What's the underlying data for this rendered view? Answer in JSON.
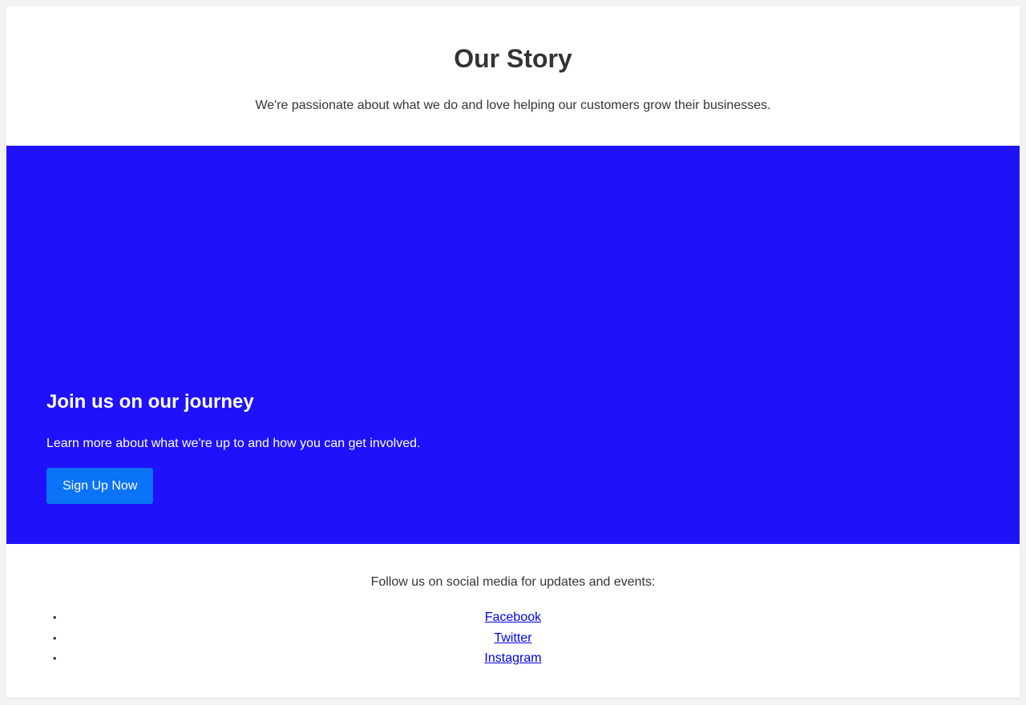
{
  "header": {
    "title": "Our Story",
    "tagline": "We're passionate about what we do and love helping our customers grow their businesses."
  },
  "hero": {
    "heading": "Join us on our journey",
    "text": "Learn more about what we're up to and how you can get involved.",
    "button_label": "Sign Up Now"
  },
  "footer": {
    "intro": "Follow us on social media for updates and events:",
    "links": [
      {
        "label": "Facebook"
      },
      {
        "label": "Twitter"
      },
      {
        "label": "Instagram"
      }
    ]
  },
  "colors": {
    "page_background": "#f3f3f3",
    "content_background": "#ffffff",
    "hero_background": "#1f12fb",
    "button_background": "#0a73f7",
    "text": "#333333",
    "link": "#0000ee"
  }
}
